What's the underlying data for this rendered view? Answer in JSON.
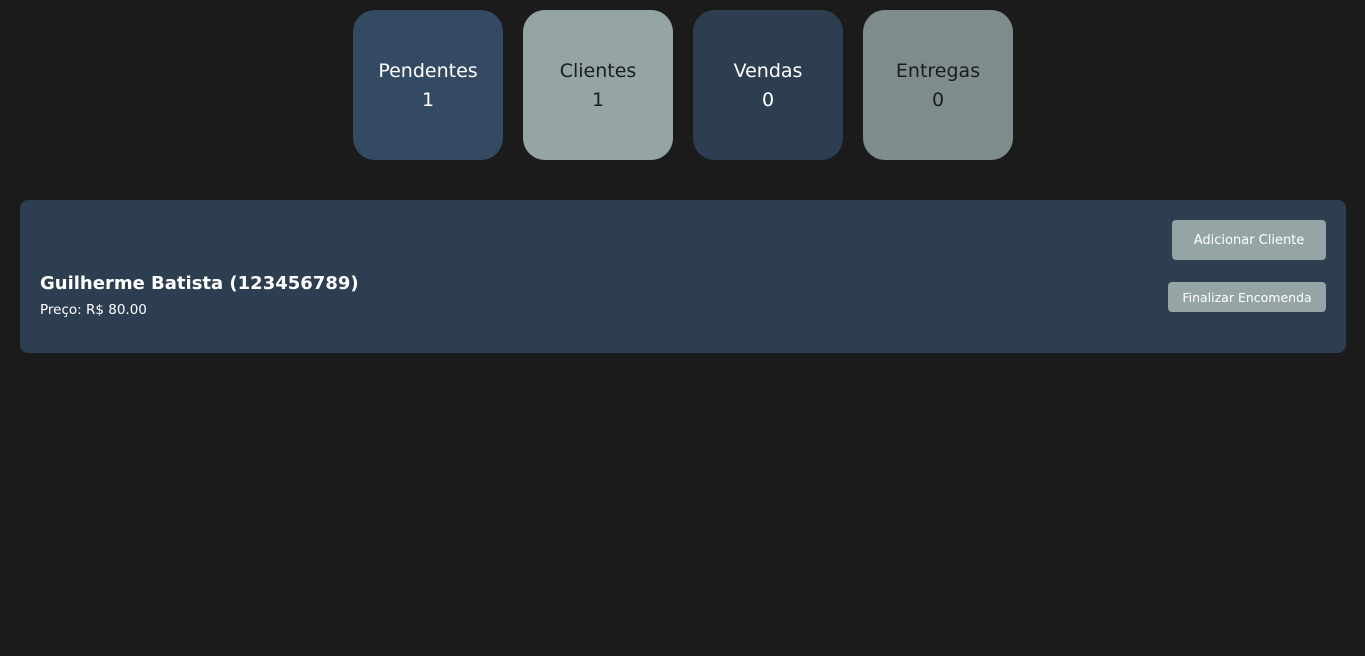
{
  "stats": [
    {
      "label": "Pendentes",
      "value": "1"
    },
    {
      "label": "Clientes",
      "value": "1"
    },
    {
      "label": "Vendas",
      "value": "0"
    },
    {
      "label": "Entregas",
      "value": "0"
    }
  ],
  "order": {
    "title": "Guilherme Batista (123456789)",
    "price": "Preço: R$ 80.00"
  },
  "actions": {
    "add_client_label": "Adicionar Cliente",
    "finish_order_label": "Finalizar Encomenda"
  },
  "colors": {
    "background": "#1b1b1b",
    "pendentes": "#344a62",
    "clientes": "#95a5a6",
    "vendas": "#2d3e51",
    "entregas": "#7f8c8d",
    "button": "#95a5a6"
  }
}
